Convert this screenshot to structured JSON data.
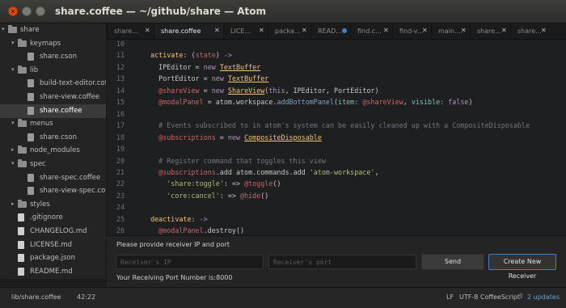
{
  "window": {
    "title": "share.coffee — ~/github/share — Atom"
  },
  "tree": {
    "items": [
      {
        "label": "share",
        "kind": "folder",
        "depth": 0,
        "expanded": true
      },
      {
        "label": "keymaps",
        "kind": "folder",
        "depth": 1,
        "expanded": true
      },
      {
        "label": "share.cson",
        "kind": "file",
        "depth": 2
      },
      {
        "label": "lib",
        "kind": "folder",
        "depth": 1,
        "expanded": true
      },
      {
        "label": "build-text-editor.coffee",
        "kind": "file",
        "depth": 2
      },
      {
        "label": "share-view.coffee",
        "kind": "file",
        "depth": 2
      },
      {
        "label": "share.coffee",
        "kind": "file",
        "depth": 2,
        "selected": true
      },
      {
        "label": "menus",
        "kind": "folder",
        "depth": 1,
        "expanded": true
      },
      {
        "label": "share.cson",
        "kind": "file",
        "depth": 2
      },
      {
        "label": "node_modules",
        "kind": "folder",
        "depth": 1,
        "expanded": false
      },
      {
        "label": "spec",
        "kind": "folder",
        "depth": 1,
        "expanded": true
      },
      {
        "label": "share-spec.coffee",
        "kind": "file",
        "depth": 2
      },
      {
        "label": "share-view-spec.coffee",
        "kind": "file",
        "depth": 2
      },
      {
        "label": "styles",
        "kind": "folder",
        "depth": 1,
        "expanded": false
      },
      {
        "label": ".gitignore",
        "kind": "file",
        "depth": 1
      },
      {
        "label": "CHANGELOG.md",
        "kind": "file",
        "depth": 1
      },
      {
        "label": "LICENSE.md",
        "kind": "file",
        "depth": 1
      },
      {
        "label": "package.json",
        "kind": "file",
        "depth": 1
      },
      {
        "label": "README.md",
        "kind": "file",
        "depth": 1
      },
      {
        "label": "share.coffee",
        "kind": "file",
        "depth": 1
      }
    ]
  },
  "tabs": [
    {
      "label": "share...",
      "active": false,
      "modified": false
    },
    {
      "label": "share.coffee",
      "active": true,
      "modified": false
    },
    {
      "label": "LICE...",
      "active": false,
      "modified": false
    },
    {
      "label": "packa...",
      "active": false,
      "modified": false
    },
    {
      "label": "READ...",
      "active": false,
      "modified": true
    },
    {
      "label": "find.c...",
      "active": false,
      "modified": false
    },
    {
      "label": "find-v...",
      "active": false,
      "modified": false
    },
    {
      "label": "main....",
      "active": false,
      "modified": false
    },
    {
      "label": "share...",
      "active": false,
      "modified": false
    },
    {
      "label": "share...",
      "active": false,
      "modified": false
    }
  ],
  "editor": {
    "lines": [
      {
        "n": "10",
        "tokens": []
      },
      {
        "n": "11",
        "tokens": [
          {
            "t": "  ",
            "c": "pl"
          },
          {
            "t": "activate",
            "c": "fn"
          },
          {
            "t": ": (",
            "c": "pl"
          },
          {
            "t": "state",
            "c": "var"
          },
          {
            "t": ") ",
            "c": "pl"
          },
          {
            "t": "->",
            "c": "kw"
          }
        ]
      },
      {
        "n": "12",
        "tokens": [
          {
            "t": "    ",
            "c": "pl"
          },
          {
            "t": "IPEditor",
            "c": "pl"
          },
          {
            "t": " = ",
            "c": "pl"
          },
          {
            "t": "new ",
            "c": "kw"
          },
          {
            "t": "TextBuffer",
            "c": "cls"
          }
        ]
      },
      {
        "n": "13",
        "tokens": [
          {
            "t": "    ",
            "c": "pl"
          },
          {
            "t": "PortEditor",
            "c": "pl"
          },
          {
            "t": " = ",
            "c": "pl"
          },
          {
            "t": "new ",
            "c": "kw"
          },
          {
            "t": "TextBuffer",
            "c": "cls"
          }
        ]
      },
      {
        "n": "14",
        "tokens": [
          {
            "t": "    ",
            "c": "pl"
          },
          {
            "t": "@shareView",
            "c": "var"
          },
          {
            "t": " = ",
            "c": "pl"
          },
          {
            "t": "new ",
            "c": "kw"
          },
          {
            "t": "ShareView",
            "c": "cls"
          },
          {
            "t": "(",
            "c": "pl"
          },
          {
            "t": "this",
            "c": "kw"
          },
          {
            "t": ", IPEditor, PortEditor)",
            "c": "pl"
          }
        ]
      },
      {
        "n": "15",
        "tokens": [
          {
            "t": "    ",
            "c": "pl"
          },
          {
            "t": "@modalPanel",
            "c": "var"
          },
          {
            "t": " = atom.workspace.",
            "c": "pl"
          },
          {
            "t": "addBottomPanel",
            "c": "ik"
          },
          {
            "t": "(",
            "c": "pl"
          },
          {
            "t": "item:",
            "c": "prop"
          },
          {
            "t": " ",
            "c": "pl"
          },
          {
            "t": "@shareView",
            "c": "var"
          },
          {
            "t": ", ",
            "c": "pl"
          },
          {
            "t": "visible:",
            "c": "prop"
          },
          {
            "t": " ",
            "c": "pl"
          },
          {
            "t": "false",
            "c": "kw"
          },
          {
            "t": ")",
            "c": "pl"
          }
        ]
      },
      {
        "n": "16",
        "tokens": []
      },
      {
        "n": "17",
        "tokens": [
          {
            "t": "    # Events subscribed to in atom's system can be easily cleaned up with a CompositeDisposable",
            "c": "cm"
          }
        ]
      },
      {
        "n": "18",
        "tokens": [
          {
            "t": "    ",
            "c": "pl"
          },
          {
            "t": "@subscriptions",
            "c": "var"
          },
          {
            "t": " = ",
            "c": "pl"
          },
          {
            "t": "new ",
            "c": "kw"
          },
          {
            "t": "CompositeDisposable",
            "c": "cls"
          }
        ]
      },
      {
        "n": "19",
        "tokens": []
      },
      {
        "n": "20",
        "tokens": [
          {
            "t": "    # Register command that toggles this view",
            "c": "cm"
          }
        ]
      },
      {
        "n": "21",
        "tokens": [
          {
            "t": "    ",
            "c": "pl"
          },
          {
            "t": "@subscriptions",
            "c": "var"
          },
          {
            "t": ".add atom.commands.add ",
            "c": "pl"
          },
          {
            "t": "'atom-workspace'",
            "c": "str"
          },
          {
            "t": ",",
            "c": "pl"
          }
        ]
      },
      {
        "n": "22",
        "tokens": [
          {
            "t": "      ",
            "c": "pl"
          },
          {
            "t": "'share:toggle'",
            "c": "str"
          },
          {
            "t": ": => ",
            "c": "pl"
          },
          {
            "t": "@toggle",
            "c": "var"
          },
          {
            "t": "()",
            "c": "pl"
          }
        ]
      },
      {
        "n": "23",
        "tokens": [
          {
            "t": "      ",
            "c": "pl"
          },
          {
            "t": "'core:cancel'",
            "c": "str"
          },
          {
            "t": ": => ",
            "c": "pl"
          },
          {
            "t": "@hide",
            "c": "var"
          },
          {
            "t": "()",
            "c": "pl"
          }
        ]
      },
      {
        "n": "24",
        "tokens": []
      },
      {
        "n": "25",
        "tokens": [
          {
            "t": "  ",
            "c": "pl"
          },
          {
            "t": "deactivate",
            "c": "fn"
          },
          {
            "t": ": ",
            "c": "pl"
          },
          {
            "t": "->",
            "c": "kw"
          }
        ]
      },
      {
        "n": "26",
        "tokens": [
          {
            "t": "    ",
            "c": "pl"
          },
          {
            "t": "@modalPanel",
            "c": "var"
          },
          {
            "t": ".destroy()",
            "c": "pl"
          }
        ]
      },
      {
        "n": "27",
        "tokens": [
          {
            "t": "    ",
            "c": "pl"
          },
          {
            "t": "@subscriptions",
            "c": "var"
          },
          {
            "t": ".dispose()",
            "c": "pl"
          }
        ]
      }
    ]
  },
  "panel": {
    "prompt": "Please provide receiver IP and port",
    "ip_placeholder": "Receiver's IP",
    "port_placeholder": "Receiver's port",
    "send_label": "Send",
    "create_label": "Create New Receiver",
    "port_info": "Your Receiving Port Number is:8000"
  },
  "status": {
    "path": "lib/share.coffee",
    "cursor": "42:22",
    "line_ending": "LF",
    "encoding": "UTF-8",
    "grammar": "CoffeeScript",
    "updates": "2 updates"
  },
  "colors": {
    "accent": "#3f83c6",
    "close_button": "#df4b16",
    "background": "#1d1f21"
  }
}
